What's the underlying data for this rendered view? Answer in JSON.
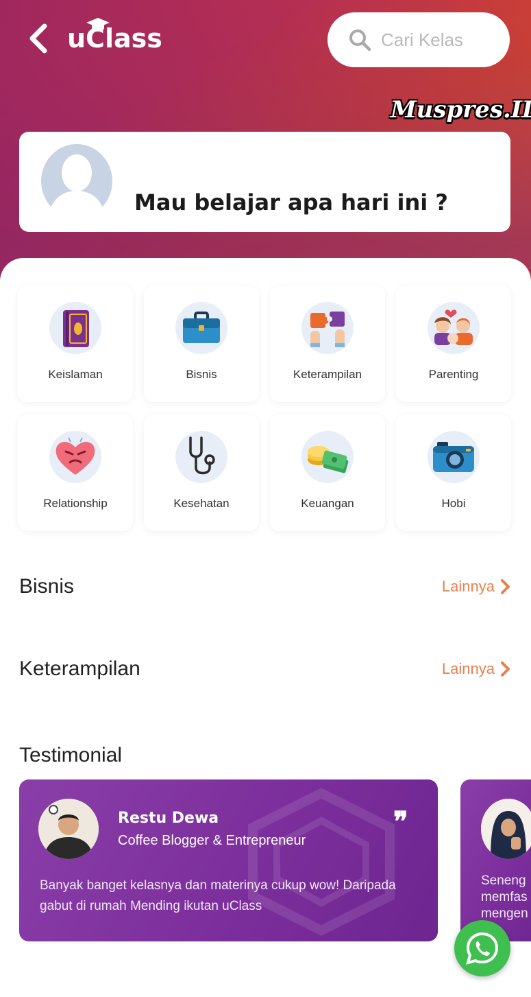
{
  "header": {
    "logo_text": "uClass",
    "search_placeholder": "Cari Kelas",
    "watermark": "Muspres.ID"
  },
  "greeting": {
    "text": "Mau belajar apa hari ini ?"
  },
  "categories": [
    {
      "label": "Keislaman",
      "icon": "quran-book-icon"
    },
    {
      "label": "Bisnis",
      "icon": "briefcase-icon"
    },
    {
      "label": "Keterampilan",
      "icon": "puzzle-hands-icon"
    },
    {
      "label": "Parenting",
      "icon": "family-icon"
    },
    {
      "label": "Relationship",
      "icon": "heart-face-icon"
    },
    {
      "label": "Kesehatan",
      "icon": "stethoscope-icon"
    },
    {
      "label": "Keuangan",
      "icon": "money-stack-icon"
    },
    {
      "label": "Hobi",
      "icon": "camera-icon"
    }
  ],
  "sections": [
    {
      "title": "Bisnis",
      "more": "Lainnya"
    },
    {
      "title": "Keterampilan",
      "more": "Lainnya"
    }
  ],
  "testimonial": {
    "title": "Testimonial",
    "items": [
      {
        "name": "Restu Dewa",
        "role": "Coffee Blogger & Entrepreneur",
        "text": "Banyak banget kelasnya dan materinya cukup wow! Daripada gabut di rumah Mending ikutan uClass"
      },
      {
        "text_lines": [
          "Seneng",
          "memfas",
          "mengen"
        ]
      }
    ]
  },
  "colors": {
    "accent": "#e7814e",
    "testimonial_bg": "#7c2f9c",
    "whatsapp": "#3fbf4f"
  }
}
